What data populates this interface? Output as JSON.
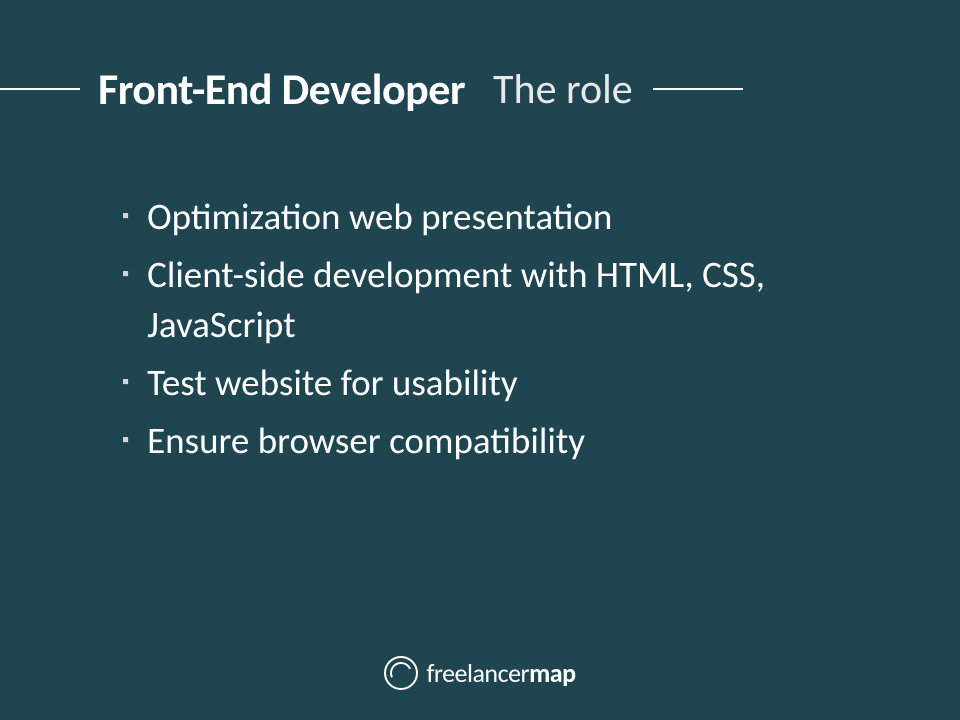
{
  "header": {
    "title_bold": "Front-End Developer",
    "title_regular": "The role"
  },
  "bullets": [
    "Optimization web presentation",
    "Client-side development with HTML, CSS, JavaScript",
    "Test website for usability",
    "Ensure browser compatibility"
  ],
  "footer": {
    "brand_prefix": "freelancer",
    "brand_suffix": "map"
  }
}
